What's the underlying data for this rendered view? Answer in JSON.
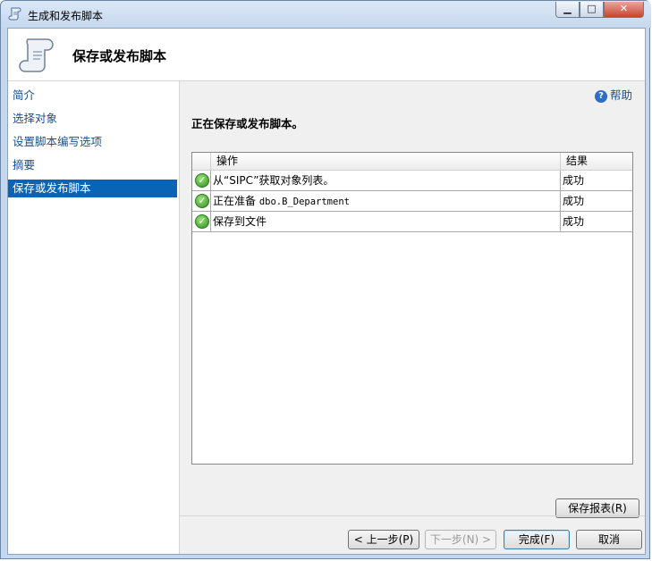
{
  "window": {
    "title": "生成和发布脚本"
  },
  "header": {
    "title": "保存或发布脚本"
  },
  "nav": {
    "items": [
      {
        "label": "简介",
        "active": false
      },
      {
        "label": "选择对象",
        "active": false
      },
      {
        "label": "设置脚本编写选项",
        "active": false
      },
      {
        "label": "摘要",
        "active": false
      },
      {
        "label": "保存或发布脚本",
        "active": true
      }
    ]
  },
  "main": {
    "help_label": "帮助",
    "status": "正在保存或发布脚本。",
    "table": {
      "columns": [
        "操作",
        "结果"
      ],
      "rows": [
        {
          "op_prefix": "从“SIPC”获取对象列表。",
          "op_mono": "",
          "result": "成功"
        },
        {
          "op_prefix": "正在准备 ",
          "op_mono": "dbo.B_Department",
          "result": "成功"
        },
        {
          "op_prefix": "保存到文件",
          "op_mono": "",
          "result": "成功"
        }
      ]
    },
    "save_report_label": "保存报表(R)"
  },
  "footer": {
    "prev_label": "< 上一步(P)",
    "next_label": "下一步(N) >",
    "finish_label": "完成(F)",
    "cancel_label": "取消"
  },
  "colors": {
    "active_nav": "#0a64b5",
    "link": "#1c4f8f",
    "success": "#2f8f1e"
  }
}
